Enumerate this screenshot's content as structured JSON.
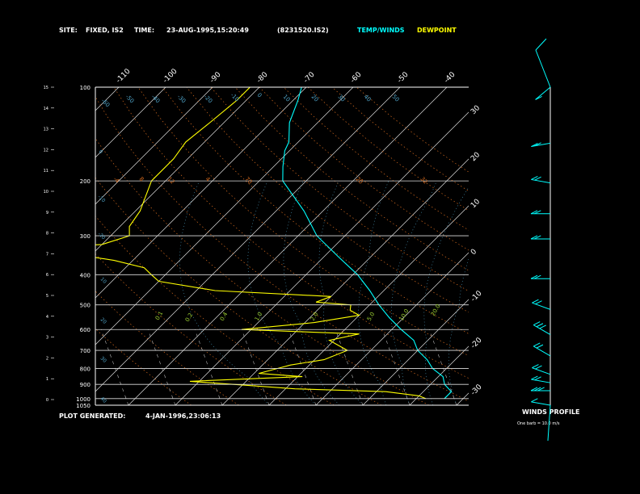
{
  "header": {
    "site_label": "SITE:",
    "site_value": "FIXED, IS2",
    "time_label": "TIME:",
    "time_value": "23-AUG-1995,15:20:49",
    "file_id": "(8231520.IS2)",
    "legend_temp": "TEMP/WINDS",
    "legend_dew": "DEWPOINT",
    "temp_color": "#00ffff",
    "dew_color": "#ffff00"
  },
  "footer": {
    "generated_label": "PLOT GENERATED:",
    "generated_value": "4-JAN-1996,23:06:13"
  },
  "winds": {
    "title": "WINDS PROFILE",
    "note": "One barb = 10.0 m/s"
  },
  "chart_data": {
    "type": "line",
    "pressure_levels": [
      1050,
      1000,
      900,
      800,
      700,
      600,
      500,
      400,
      300,
      200,
      100
    ],
    "pressure_labels": [
      "1050",
      "1000",
      "900",
      "800",
      "700",
      "600",
      "500",
      "400",
      "300",
      "200",
      "100"
    ],
    "height_ticks": [
      "0",
      "1",
      "2",
      "3",
      "4",
      "5",
      "6",
      "7",
      "8",
      "9",
      "10",
      "11",
      "12",
      "13",
      "14",
      "15"
    ],
    "temp_tick_labels_top": [
      "-110",
      "-100",
      "-90",
      "-80",
      "-70",
      "-60",
      "-50",
      "-40"
    ],
    "temp_tick_labels_right": [
      "-30",
      "-20",
      "-10",
      "0",
      "10",
      "20",
      "30"
    ],
    "dry_adiabat_labels": [
      "-60",
      "-50",
      "-40",
      "-30",
      "-20",
      "-10",
      "0",
      "10",
      "20",
      "30",
      "40",
      "50"
    ],
    "moist_labels": [
      "0.1",
      "0.2",
      "0.4",
      "1.0",
      "2.0",
      "5.0",
      "10.0",
      "20.0"
    ],
    "series": [
      {
        "name": "TEMP/WINDS",
        "points": [
          [
            1000,
            26
          ],
          [
            950,
            26
          ],
          [
            900,
            23
          ],
          [
            850,
            21
          ],
          [
            800,
            17
          ],
          [
            750,
            14
          ],
          [
            700,
            10
          ],
          [
            650,
            7
          ],
          [
            600,
            2
          ],
          [
            550,
            -3
          ],
          [
            500,
            -8
          ],
          [
            450,
            -13
          ],
          [
            400,
            -19
          ],
          [
            350,
            -27
          ],
          [
            300,
            -36
          ],
          [
            250,
            -44
          ],
          [
            200,
            -55
          ],
          [
            180,
            -58
          ],
          [
            160,
            -61
          ],
          [
            150,
            -62
          ],
          [
            130,
            -66
          ],
          [
            110,
            -69
          ],
          [
            100,
            -71
          ]
        ]
      },
      {
        "name": "DEWPOINT",
        "points": [
          [
            1000,
            22
          ],
          [
            980,
            20
          ],
          [
            950,
            12
          ],
          [
            930,
            -8
          ],
          [
            900,
            -22
          ],
          [
            880,
            -32
          ],
          [
            850,
            -9
          ],
          [
            830,
            -19
          ],
          [
            800,
            -16
          ],
          [
            780,
            -14
          ],
          [
            750,
            -8
          ],
          [
            700,
            -5
          ],
          [
            650,
            -11
          ],
          [
            620,
            -6
          ],
          [
            600,
            -32
          ],
          [
            570,
            -18
          ],
          [
            540,
            -10
          ],
          [
            520,
            -13
          ],
          [
            500,
            -14
          ],
          [
            490,
            -22
          ],
          [
            470,
            -20
          ],
          [
            450,
            -46
          ],
          [
            420,
            -60
          ],
          [
            400,
            -63
          ],
          [
            380,
            -66
          ],
          [
            360,
            -74
          ],
          [
            340,
            -86
          ],
          [
            330,
            -96
          ],
          [
            320,
            -80
          ],
          [
            300,
            -76
          ],
          [
            280,
            -78
          ],
          [
            250,
            -79
          ],
          [
            200,
            -83
          ],
          [
            170,
            -83
          ],
          [
            150,
            -84
          ],
          [
            130,
            -83
          ],
          [
            110,
            -82
          ],
          [
            100,
            -82
          ]
        ]
      }
    ],
    "winds_profile": [
      [
        1000,
        280,
        5
      ],
      [
        900,
        270,
        25
      ],
      [
        850,
        280,
        20
      ],
      [
        800,
        290,
        15
      ],
      [
        700,
        300,
        20
      ],
      [
        600,
        300,
        25
      ],
      [
        500,
        290,
        20
      ],
      [
        400,
        270,
        15
      ],
      [
        300,
        270,
        20
      ],
      [
        250,
        270,
        15
      ],
      [
        200,
        280,
        20
      ],
      [
        150,
        260,
        15
      ],
      [
        100,
        230,
        10
      ]
    ]
  }
}
